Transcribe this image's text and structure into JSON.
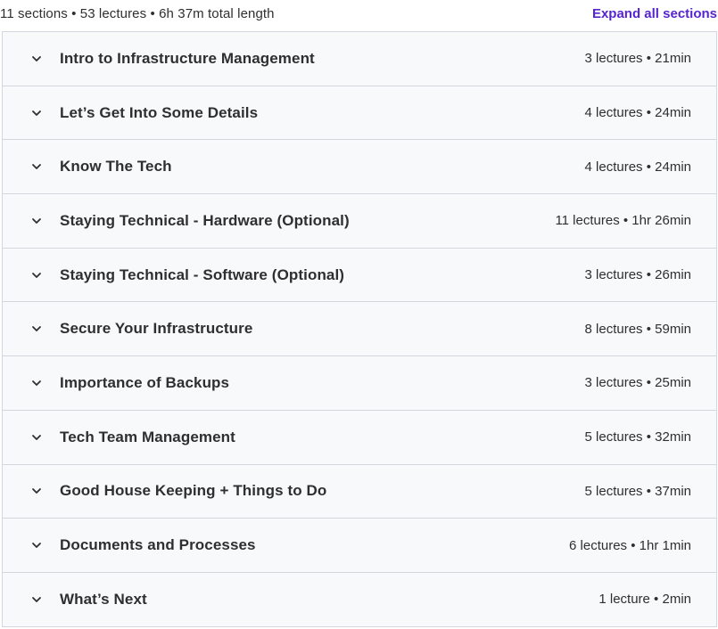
{
  "summary": {
    "text": "11 sections • 53 lectures • 6h 37m total length",
    "expand_label": "Expand all sections"
  },
  "sections": [
    {
      "title": "Intro to Infrastructure Management",
      "meta": "3 lectures • 21min"
    },
    {
      "title": "Let’s Get Into Some Details",
      "meta": "4 lectures • 24min"
    },
    {
      "title": "Know The Tech",
      "meta": "4 lectures • 24min"
    },
    {
      "title": "Staying Technical - Hardware (Optional)",
      "meta": "11 lectures • 1hr 26min"
    },
    {
      "title": "Staying Technical - Software (Optional)",
      "meta": "3 lectures • 26min"
    },
    {
      "title": "Secure Your Infrastructure",
      "meta": "8 lectures • 59min"
    },
    {
      "title": "Importance of Backups",
      "meta": "3 lectures • 25min"
    },
    {
      "title": "Tech Team Management",
      "meta": "5 lectures • 32min"
    },
    {
      "title": "Good House Keeping + Things to Do",
      "meta": "5 lectures • 37min"
    },
    {
      "title": "Documents and Processes",
      "meta": "6 lectures • 1hr 1min"
    },
    {
      "title": "What’s Next",
      "meta": "1 lecture • 2min"
    }
  ],
  "icons": {
    "chevron": "chevron-down-icon"
  },
  "colors": {
    "accent": "#5624d0",
    "row_background": "#f7f9fa",
    "border": "#d1d7dc",
    "text": "#2d2f31"
  }
}
